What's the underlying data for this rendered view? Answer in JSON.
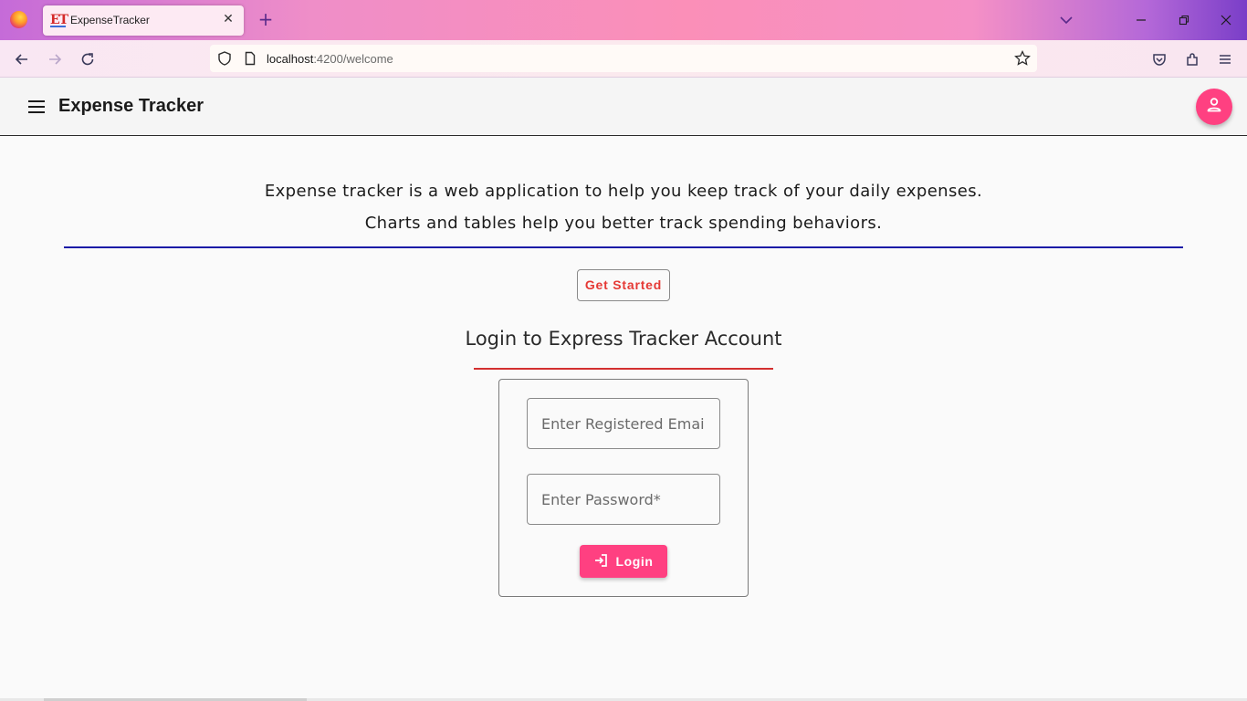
{
  "browser": {
    "tab_title": "ExpenseTracker",
    "tab_favicon_text": "ET",
    "new_tab_symbol": "+",
    "close_tab_symbol": "✕",
    "url_host": "localhost",
    "url_path": ":4200/welcome",
    "icons": [
      "firefox-icon",
      "back-icon",
      "forward-icon",
      "reload-icon",
      "shield-icon",
      "page-icon",
      "star-icon",
      "pocket-icon",
      "extensions-icon",
      "menu-icon",
      "list-all-tabs-icon",
      "minimize-icon",
      "restore-icon",
      "close-icon"
    ]
  },
  "toolbar": {
    "title": "Expense Tracker",
    "menu_icon": "menu-icon",
    "account_icon": "person-icon"
  },
  "main": {
    "intro_line_1": "Expense tracker is a web application to help you keep track of your daily expenses.",
    "intro_line_2": "Charts and tables help you better track spending behaviors.",
    "get_started_label": "Get Started",
    "login_heading": "Login to Express Tracker Account",
    "email_placeholder": "Enter Registered Email*",
    "password_placeholder": "Enter Password*",
    "login_label": "Login"
  },
  "colors": {
    "accent_pink": "#ff4081",
    "get_started_text": "#e53935",
    "blue_rule": "#1a1aa6",
    "red_rule": "#d32f2f"
  }
}
